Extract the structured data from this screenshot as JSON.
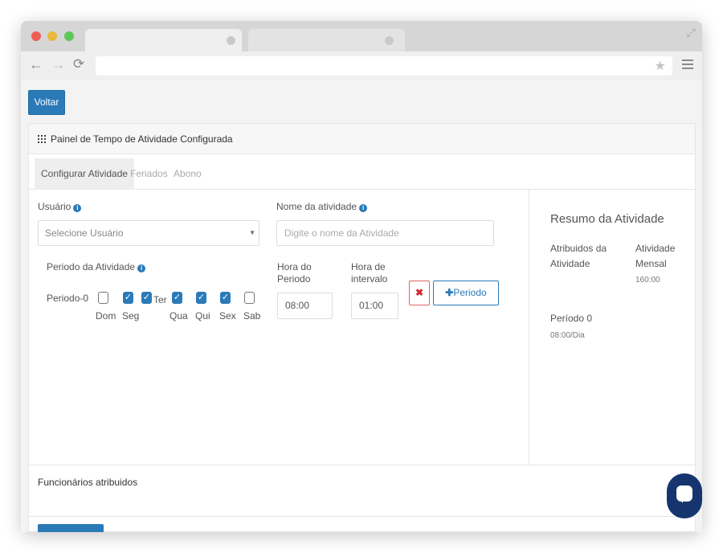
{
  "page": {
    "back_button": "Voltar",
    "panel_title": "Painel de Tempo de Atividade Configurada",
    "tabs": [
      "Configurar Atividade",
      "Feriados",
      "Abono"
    ],
    "form": {
      "user_label": "Usuário",
      "user_placeholder": "Selecione Usuário",
      "activity_name_label": "Nome da atividade",
      "activity_name_placeholder": "Digite o nome da Atividade",
      "period_section_label": "Periodo da Atividade",
      "period_start_label": "Hora do Periodo",
      "interval_label": "Hora de intervalo",
      "period_row_label": "Periodo-0",
      "period_start_value": "08:00",
      "interval_value": "01:00",
      "add_period_button": "Periodo",
      "days": [
        {
          "label": "Dom",
          "checked": false
        },
        {
          "label": "Seg",
          "checked": true
        },
        {
          "label": "Ter",
          "checked": true
        },
        {
          "label": "Qua",
          "checked": true
        },
        {
          "label": "Qui",
          "checked": true
        },
        {
          "label": "Sex",
          "checked": true
        },
        {
          "label": "Sab",
          "checked": false
        }
      ]
    },
    "summary": {
      "title": "Resumo da Atividade",
      "col1_header": "Atribuidos da Atividade",
      "col2_header": "Atividade Mensal",
      "monthly_value": "160:00",
      "period_label": "Período 0",
      "period_value": "08:00/Dia"
    },
    "assigned_title": "Funcionários atribuidos"
  },
  "icons": {
    "back": "arrow-left-icon",
    "forward": "arrow-right-icon",
    "reload": "reload-icon",
    "star": "star-icon",
    "menu": "hamburger-menu-icon",
    "grid": "grid-icon",
    "info": "info-icon",
    "remove": "close-icon",
    "add": "plus-icon",
    "chat": "chat-bubble-icon"
  },
  "colors": {
    "primary": "#2a7ab8",
    "danger": "#d8252f",
    "chat": "#16356f"
  }
}
